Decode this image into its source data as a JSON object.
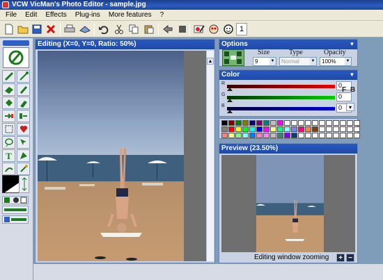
{
  "app": {
    "title": "VCW VicMan's Photo Editor - sample.jpg"
  },
  "menu": {
    "items": [
      "File",
      "Edit",
      "Effects",
      "Plug-ins",
      "More features",
      "?"
    ]
  },
  "toolbar": {
    "icons": [
      "new-icon",
      "open-icon",
      "save-icon",
      "close-icon",
      "print-icon",
      "scan-icon",
      "undo-icon",
      "cut-icon",
      "copy-icon",
      "paste-icon",
      "rotate-icon",
      "crop-icon",
      "paint-icon",
      "redeye-icon",
      "face-icon"
    ],
    "counter": "1"
  },
  "editing": {
    "title": "Editing (X=0, Y=0, Ratio: 50%)"
  },
  "options": {
    "title": "Options",
    "size_label": "Size",
    "type_label": "Type",
    "opacity_label": "Opacity",
    "size_value": "9",
    "type_value": "Normal",
    "opacity_value": "100%"
  },
  "color": {
    "title": "Color",
    "r_label": "R",
    "g_label": "G",
    "b_label": "B",
    "r_value": "0",
    "g_value": "0",
    "b_value": "0",
    "f_label": "F",
    "bk_label": "B"
  },
  "palette_colors": [
    "#000000",
    "#800000",
    "#008000",
    "#808000",
    "#000080",
    "#800080",
    "#008080",
    "#c0c0c0",
    "#ff00ff",
    "#ffffff",
    "#ffffff",
    "#ffffff",
    "#ffffff",
    "#ffffff",
    "#ffffff",
    "#ffffff",
    "#ffffff",
    "#ffffff",
    "#ffffff",
    "#ffffff",
    "#808080",
    "#ff0000",
    "#ffff00",
    "#00ff00",
    "#00ffff",
    "#0000ff",
    "#ff00ff",
    "#ffff80",
    "#00ff80",
    "#80ffff",
    "#8080ff",
    "#ff0080",
    "#ff8040",
    "#804000",
    "#ffffff",
    "#ffffff",
    "#ffffff",
    "#ffffff",
    "#ffffff",
    "#ffffff",
    "#ff8080",
    "#ffff80",
    "#80ff80",
    "#80ffff",
    "#0080ff",
    "#ff80c0",
    "#ff80ff",
    "#c0c0c0",
    "#408080",
    "#8000ff",
    "#004080",
    "#ffffff",
    "#ffffff",
    "#ffffff",
    "#ffffff",
    "#ffffff",
    "#ffffff",
    "#ffffff",
    "#ffffff",
    "#ffffff"
  ],
  "preview": {
    "title": "Preview (23.50%)",
    "zoom_label": "Editing window zooming",
    "zoom_in": "+",
    "zoom_out": "−"
  }
}
